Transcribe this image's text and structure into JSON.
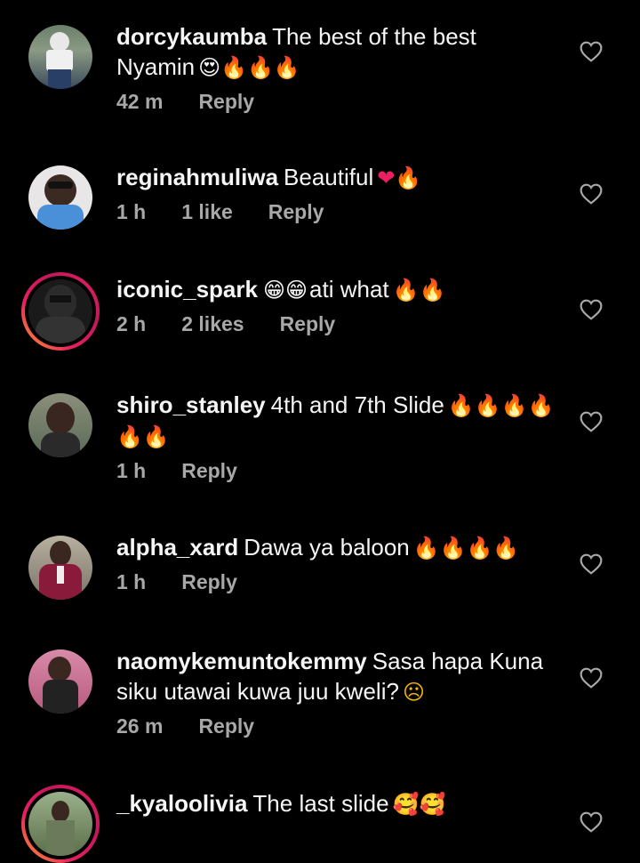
{
  "comments": [
    {
      "username": "dorcykaumba",
      "text": "The best of the best Nyamin",
      "emoji": "😍🔥🔥🔥",
      "time": "42 m",
      "likes": "",
      "reply": "Reply"
    },
    {
      "username": "reginahmuliwa",
      "text": "Beautiful",
      "emoji": "❤🔥",
      "time": "1 h",
      "likes": "1 like",
      "reply": "Reply"
    },
    {
      "username": "iconic_spark",
      "text": "ati what",
      "emoji_before": "😁😁",
      "emoji": "🔥🔥",
      "time": "2 h",
      "likes": "2 likes",
      "reply": "Reply"
    },
    {
      "username": "shiro_stanley",
      "text": "4th and 7th Slide",
      "emoji": "🔥🔥🔥🔥🔥🔥",
      "time": "1 h",
      "likes": "",
      "reply": "Reply"
    },
    {
      "username": "alpha_xard",
      "text": "Dawa ya baloon",
      "emoji": "🔥🔥🔥🔥",
      "time": "1 h",
      "likes": "",
      "reply": "Reply"
    },
    {
      "username": "naomykemuntokemmy",
      "text": "Sasa hapa Kuna siku utawai kuwa juu kweli?",
      "emoji": "☹",
      "time": "26 m",
      "likes": "",
      "reply": "Reply"
    },
    {
      "username": "_kyaloolivia",
      "text": "The last slide",
      "emoji": "🥰🥰",
      "time": "",
      "likes": "",
      "reply": ""
    }
  ]
}
